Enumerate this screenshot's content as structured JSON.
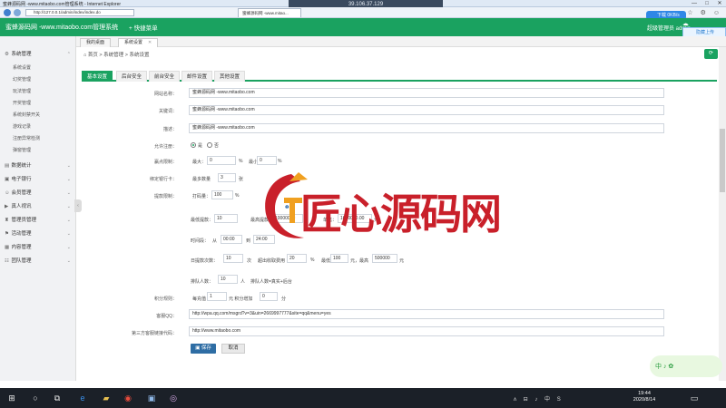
{
  "window": {
    "title": "蜜蜂源码网 -www.mitaobo.com管理系统 - Internet Explorer",
    "remote_ip": "39.106.37.129",
    "address": "http://127.0.0.1/admin/index/index.do",
    "tab_label": "蜜蜂源码网 -www.mitao...",
    "net_widget": "下载 0KB/s",
    "login_widget": "隐藏上传"
  },
  "header": {
    "title": "蜜蜂源码网 -www.mitaobo.com管理系统",
    "quick_menu": "+ 快捷菜单",
    "admin": "超级管理员  admin"
  },
  "page_tabs": [
    {
      "label": "我的桌面"
    },
    {
      "label": "系统设置"
    }
  ],
  "sidebar": {
    "groups": [
      {
        "label": "系统管理",
        "items": [
          "系统设置",
          "幻奖管理",
          "玩法管理",
          "开奖管理",
          "系统封禁开关",
          "游戏记录",
          "注册异常检测",
          "弹窗管理"
        ]
      },
      {
        "label": "数据统计"
      },
      {
        "label": "电子银行"
      },
      {
        "label": "会员管理"
      },
      {
        "label": "真人视讯"
      },
      {
        "label": "管理员管理"
      },
      {
        "label": "活动管理"
      },
      {
        "label": "内容管理"
      },
      {
        "label": "团队管理"
      }
    ]
  },
  "breadcrumb": {
    "home": "首页",
    "sep": ">",
    "level1": "系统管理",
    "level2": "系统设置"
  },
  "form_tabs": [
    "基本设置",
    "后台安全",
    "前台安全",
    "邮件设置",
    "其他设置"
  ],
  "form": {
    "site_name_label": "网站名称：",
    "site_name": "蜜蜂源码网 -www.mitaobo.com",
    "keywords_label": "关键词：",
    "keywords": "蜜蜂源码网 -www.mitaobo.com",
    "description_label": "描述：",
    "description": "蜜蜂源码网 -www.mitaobo.com",
    "register_label": "允许注册：",
    "register_yes": "是",
    "register_no": "否",
    "win_limit_label": "赢点限制：",
    "max_label": "最大：",
    "max_value": "0",
    "percent": "%",
    "min_label": "最小：",
    "min_value": "0",
    "bind_card_label": "绑定银行卡：",
    "bind_card_max": "最多数量",
    "bind_card_value": "3",
    "bind_card_unit": "张",
    "withdraw_label": "提款限制：",
    "code_amount_label": "打码量：",
    "code_amount_value": "100",
    "partial1": "%",
    "partial2": "最高",
    "partial3": "最高：",
    "min_withdraw_label": "最低提款：",
    "min_withdraw_value": "10",
    "max_withdraw_label": "最高提款：",
    "max_withdraw_value": "10000000",
    "max_single_label": "单笔：",
    "max_single_value": "1000000.00",
    "yuan": "元",
    "time_label": "时间段：",
    "time_from_label": "从",
    "time_from": "00:00",
    "time_to_label": "到",
    "time_to": "24:00",
    "daily_times_label": "日提款次数：",
    "daily_times_value": "10",
    "daily_times_unit": "次",
    "over_fee_label": "超出收取费用",
    "over_fee_value": "20",
    "over_fee_unit": "%",
    "lowest_label": "最低",
    "lowest_value": "100",
    "lowest_unit": "元，最高",
    "highest_value": "500000",
    "highest_unit": "元",
    "queue_label": "排队人数：",
    "queue_value": "10",
    "queue_unit": "人",
    "queue_hint": "排队人数=真实+后台",
    "points_label": "积分规则：",
    "points_each": "每充值",
    "points_amount": "1",
    "points_yuan": "元 积分增加",
    "points_add": "0",
    "points_unit": "分",
    "qq_label": "客服QQ：",
    "qq_value": "http://wpa.qq.com/msgrd?v=3&uin=2669997777&site=qq&menu=yes",
    "third_label": "第三方客服链接代码：",
    "third_value": "http://www.mitaobo.com",
    "save_label": "保存",
    "cancel_label": "取消"
  },
  "watermark": {
    "text": "匠心源码网"
  },
  "taskbar": {
    "time": "19:44",
    "date": "2020/8/14",
    "tray": "ʌ ⊟ ♪ 中 S"
  }
}
